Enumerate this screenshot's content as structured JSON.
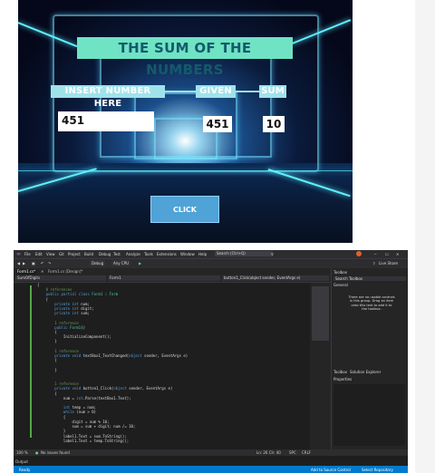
{
  "form": {
    "title": "THE SUM OF THE NUMBERS",
    "label_insert": "INSERT NUMBER HERE",
    "label_given": "GIVEN",
    "label_sum": "SUM",
    "input_value": "451",
    "given_value": "451",
    "sum_value": "10",
    "click_label": "CLICK"
  },
  "vs": {
    "menu": [
      "File",
      "Edit",
      "View",
      "Git",
      "Project",
      "Build",
      "Debug",
      "Test",
      "Analyze",
      "Tools",
      "Extensions",
      "Window",
      "Help"
    ],
    "search_placeholder": "Search (Ctrl+Q)",
    "live_share": "Live Share",
    "config": "Debug",
    "platform": "Any CPU",
    "tabs": [
      "Form1.cs*",
      "Form1.cs [Design]*"
    ],
    "nav_project": "SumOfDigits",
    "nav_class": "Form1",
    "nav_member": "button1_Click(object sender, EventArgs e)",
    "toolbox_title": "Toolbox",
    "toolbox_search": "Search Toolbox",
    "toolbox_group": "General",
    "toolbox_empty": "There are no usable controls in this group. Drag an item onto this text to add it to the toolbox.",
    "toolbox_tab": "Toolbox",
    "solution_tab": "Solution Explorer",
    "properties_title": "Properties",
    "zoom": "100 %",
    "no_issues": "No issues found",
    "ln_col": "Ln: 26  Ch: 40",
    "spc": "SPC",
    "crlf": "CRLF",
    "output_label": "Output",
    "ready": "Ready",
    "add_source": "Add to Source Control",
    "select_repo": "Select Repository"
  }
}
